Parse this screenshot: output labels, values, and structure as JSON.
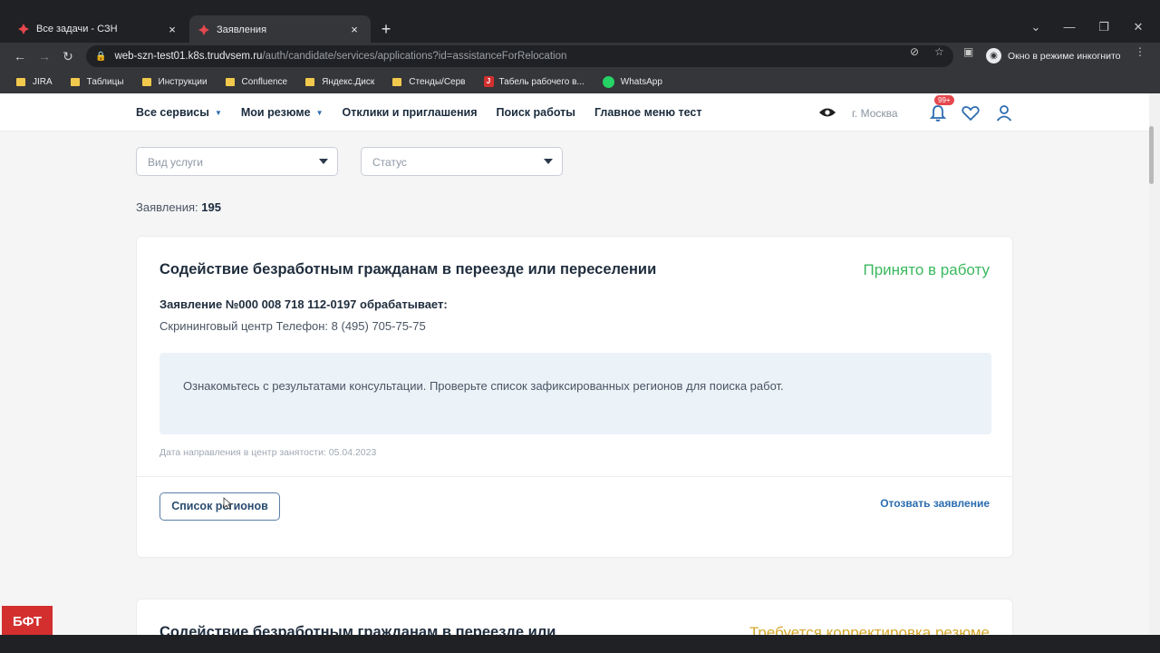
{
  "browser": {
    "tabs": [
      {
        "title": "Все задачи - СЗН",
        "close": "×"
      },
      {
        "title": "Заявления",
        "close": "×"
      }
    ],
    "new_tab": "+",
    "url_host": "web-szn-test01.k8s.trudvsem.ru",
    "url_path": "/auth/candidate/services/applications?id=assistanceForRelocation",
    "incognito_label": "Окно в режиме инкогнито",
    "bookmarks": [
      "JIRA",
      "Таблицы",
      "Инструкции",
      "Confluence",
      "Яндекс.Диск",
      "Стенды/Серв",
      "Табель рабочего в...",
      "WhatsApp"
    ]
  },
  "header": {
    "nav": [
      {
        "label": "Все сервисы",
        "dropdown": true
      },
      {
        "label": "Мои резюме",
        "dropdown": true
      },
      {
        "label": "Отклики и приглашения",
        "dropdown": false
      },
      {
        "label": "Поиск работы",
        "dropdown": false
      },
      {
        "label": "Главное меню тест",
        "dropdown": false
      }
    ],
    "city": "г. Москва",
    "notifications_badge": "99+"
  },
  "filters": {
    "service_placeholder": "Вид услуги",
    "status_placeholder": "Статус"
  },
  "applications": {
    "count_label": "Заявления:",
    "count": "195"
  },
  "card": {
    "title": "Содействие безработным гражданам в переезде или переселении",
    "status": "Принято в работу",
    "app_number": "Заявление №000 008 718 112-0197 обрабатывает:",
    "center": "Скрининговый центр Телефон: 8 (495) 705-75-75",
    "notice": "Ознакомьтесь с результатами консультации. Проверьте список зафиксированных регионов для поиска работ.",
    "date": "Дата направления в центр занятости: 05.04.2023",
    "regions_button": "Список регионов",
    "withdraw_link": "Отозвать заявление"
  },
  "card2": {
    "title": "Содействие безработным гражданам в переезде или",
    "status": "Требуется корректировка резюме"
  },
  "overlay_logo": "БФТ",
  "colors": {
    "status_accepted": "#3bb85e",
    "status_warning": "#d4a72c",
    "accent": "#2b6cb0"
  }
}
